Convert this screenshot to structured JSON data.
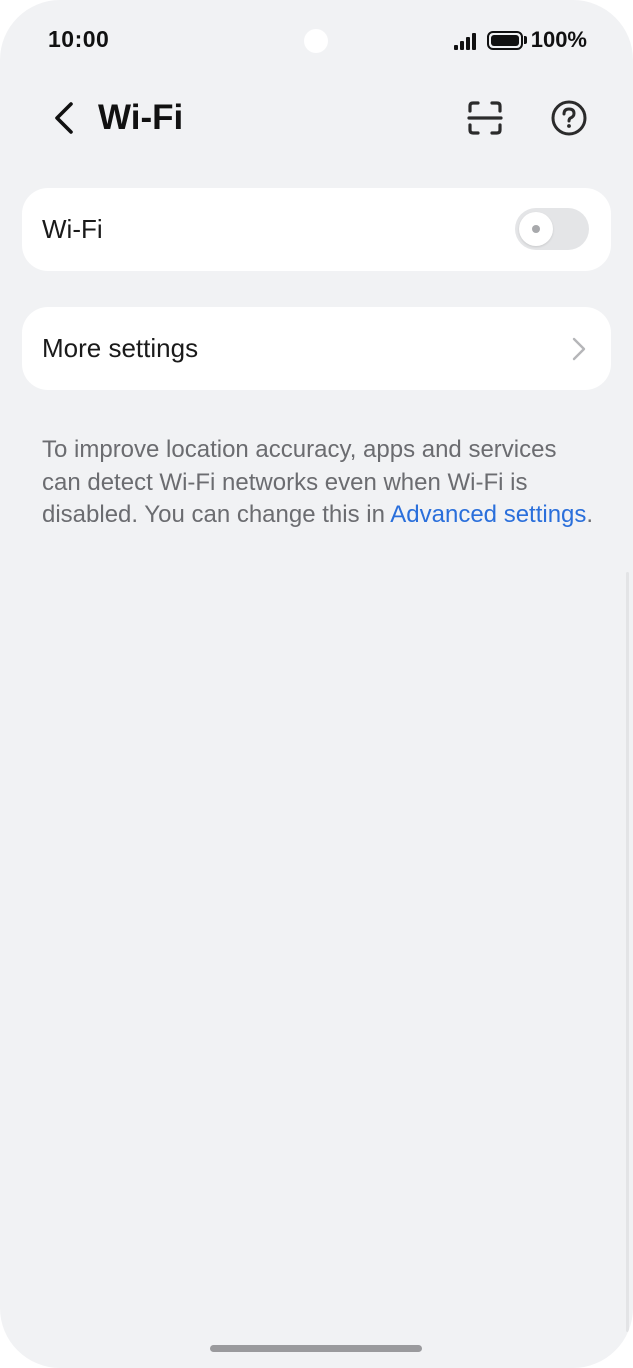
{
  "status_bar": {
    "time": "10:00",
    "battery_text": "100%",
    "signal_icon": "signal-bars-icon",
    "battery_icon": "battery-icon"
  },
  "header": {
    "back_icon": "chevron-left-icon",
    "title": "Wi-Fi",
    "scan_icon": "scan-qr-icon",
    "help_icon": "help-circle-icon"
  },
  "wifi_card": {
    "label": "Wi-Fi",
    "toggle_on": false
  },
  "more_card": {
    "label": "More settings",
    "chevron_icon": "chevron-right-icon"
  },
  "info": {
    "text": "To improve location accuracy, apps and ser­vices can detect Wi-Fi networks even when Wi-Fi is disabled. You can change this in ",
    "link_text": "Advanced settings",
    "suffix": "."
  },
  "colors": {
    "background": "#f1f2f4",
    "card": "#ffffff",
    "link": "#2a6fdb",
    "secondary_text": "#6b6c70"
  }
}
